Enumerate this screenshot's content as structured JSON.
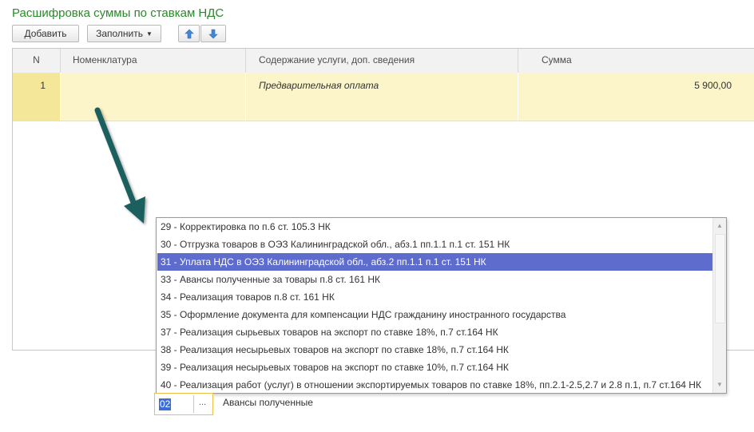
{
  "title": "Расшифровка суммы по ставкам НДС",
  "toolbar": {
    "add_label": "Добавить",
    "fill_label": "Заполнить",
    "move_up_icon": "arrow-up-icon",
    "move_down_icon": "arrow-down-icon"
  },
  "table": {
    "columns": [
      "N",
      "Номенклатура",
      "Содержание услуги, доп. сведения",
      "Сумма"
    ],
    "rows": [
      {
        "n": "1",
        "nomenclature": "",
        "content": "Предварительная оплата",
        "sum": "5 900,00"
      }
    ]
  },
  "dropdown": {
    "items": [
      "29 - Корректировка по п.6 ст. 105.3 НК",
      "30 - Отгрузка товаров в ОЭЗ Калининградской обл., абз.1 пп.1.1 п.1 ст. 151 НК",
      "31 - Уплата НДС в ОЭЗ Калининградской обл., абз.2 пп.1.1 п.1 ст. 151 НК",
      "33 - Авансы полученные за товары п.8 ст. 161 НК",
      "34 - Реализация товаров п.8 ст. 161 НК",
      "35 - Оформление документа для компенсации НДС гражданину иностранного государства",
      "37 - Реализация сырьевых товаров на экспорт по ставке 18%, п.7 ст.164 НК",
      "38 - Реализация несырьевых товаров на экспорт по ставке 18%, п.7 ст.164 НК",
      "39 - Реализация несырьевых товаров на экспорт по ставке 10%, п.7 ст.164 НК",
      "40 - Реализация работ (услуг) в отношении экспортируемых товаров по ставке 18%, пп.2.1-2.5,2.7 и 2.8 п.1, п.7 ст.164 НК"
    ],
    "selected_index": 2
  },
  "editor": {
    "value": "02",
    "select_button": "...",
    "description": "Авансы полученные"
  },
  "colors": {
    "title": "#2a8a2a",
    "row_highlight": "#fbf5c9",
    "selection": "#5d6ccd",
    "arrow": "#1e5f5f"
  }
}
